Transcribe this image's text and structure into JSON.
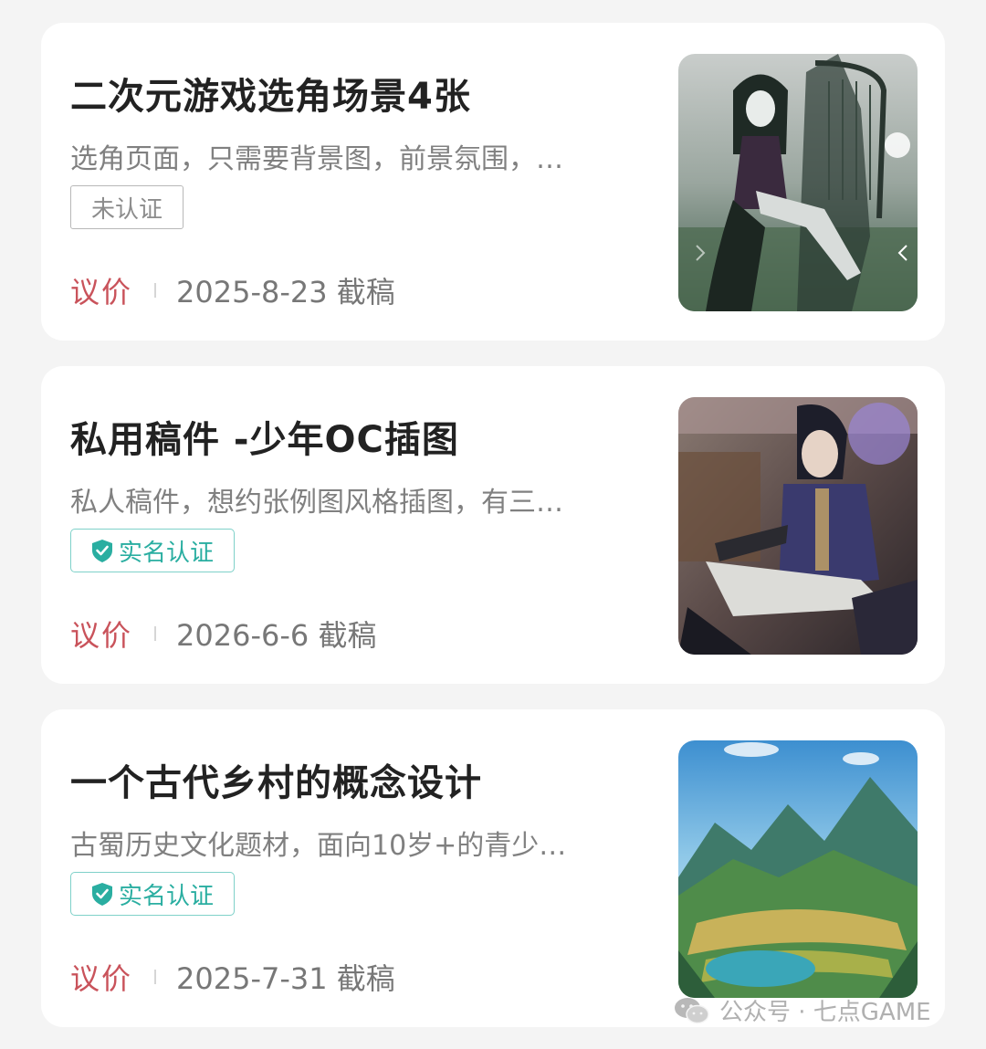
{
  "cards": [
    {
      "title": "二次元游戏选角场景4张",
      "description": "选角页面，只需要背景图，前景氛围，…",
      "badge": "未认证",
      "price": "议价",
      "deadline": "2025-8-23 截稿"
    },
    {
      "title": "私用稿件 -少年OC插图",
      "description": "私人稿件，想约张例图风格插图，有三…",
      "badge": "实名认证",
      "price": "议价",
      "deadline": "2026-6-6 截稿"
    },
    {
      "title": "一个古代乡村的概念设计",
      "description": "古蜀历史文化题材，面向10岁+的青少…",
      "badge": "实名认证",
      "price": "议价",
      "deadline": "2025-7-31 截稿"
    }
  ],
  "watermark": {
    "text": "公众号 · 七点GAME",
    "icon": "wechat-icon"
  },
  "colors": {
    "price": "#c9535b",
    "verified": "#2aaea1",
    "background": "#f4f4f4"
  }
}
